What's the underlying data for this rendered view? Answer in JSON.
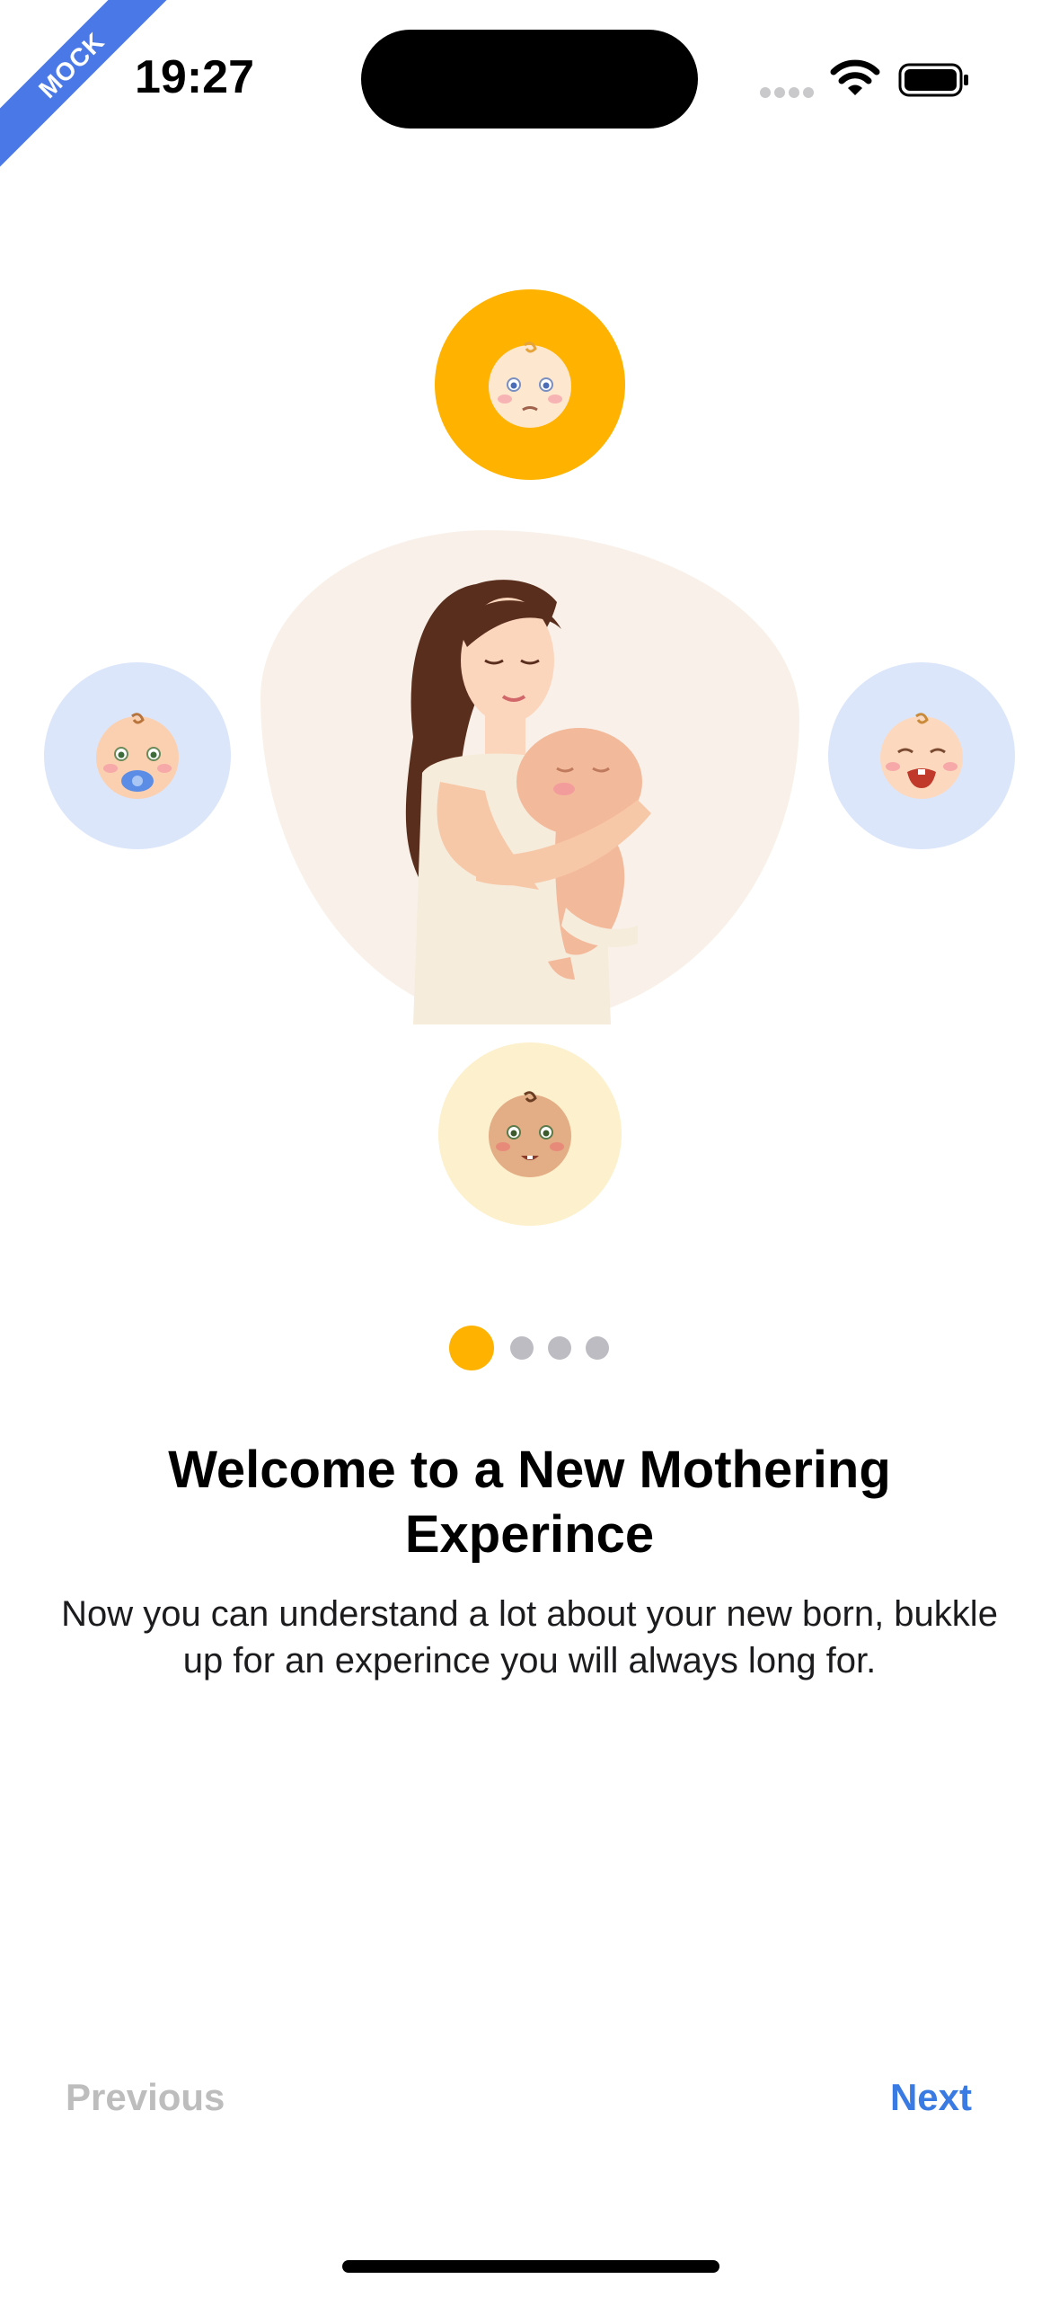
{
  "ribbon": {
    "label": "MOCK",
    "color": "#4a78e6"
  },
  "status_bar": {
    "time": "19:27",
    "icons": [
      "signal-icon",
      "wifi-icon",
      "battery-icon"
    ]
  },
  "illustration": {
    "main_image": "mother-holding-baby",
    "avatars": [
      {
        "name": "baby-face-avatar-top",
        "bg": "#ffb300"
      },
      {
        "name": "baby-with-pacifier-avatar",
        "bg": "#dce6fb"
      },
      {
        "name": "crying-baby-avatar",
        "bg": "#dce6fb"
      },
      {
        "name": "smiling-baby-avatar",
        "bg": "#fdf0cc"
      }
    ]
  },
  "pager": {
    "total": 4,
    "active_index": 0,
    "active_color": "#ffb300"
  },
  "onboarding": {
    "title": "Welcome to a New Mothering Experince",
    "subtitle": "Now you can understand a lot about your new born, bukkle up for an experince you will always long for."
  },
  "nav": {
    "previous_label": "Previous",
    "next_label": "Next",
    "previous_enabled": false,
    "accent": "#3a7be3"
  }
}
